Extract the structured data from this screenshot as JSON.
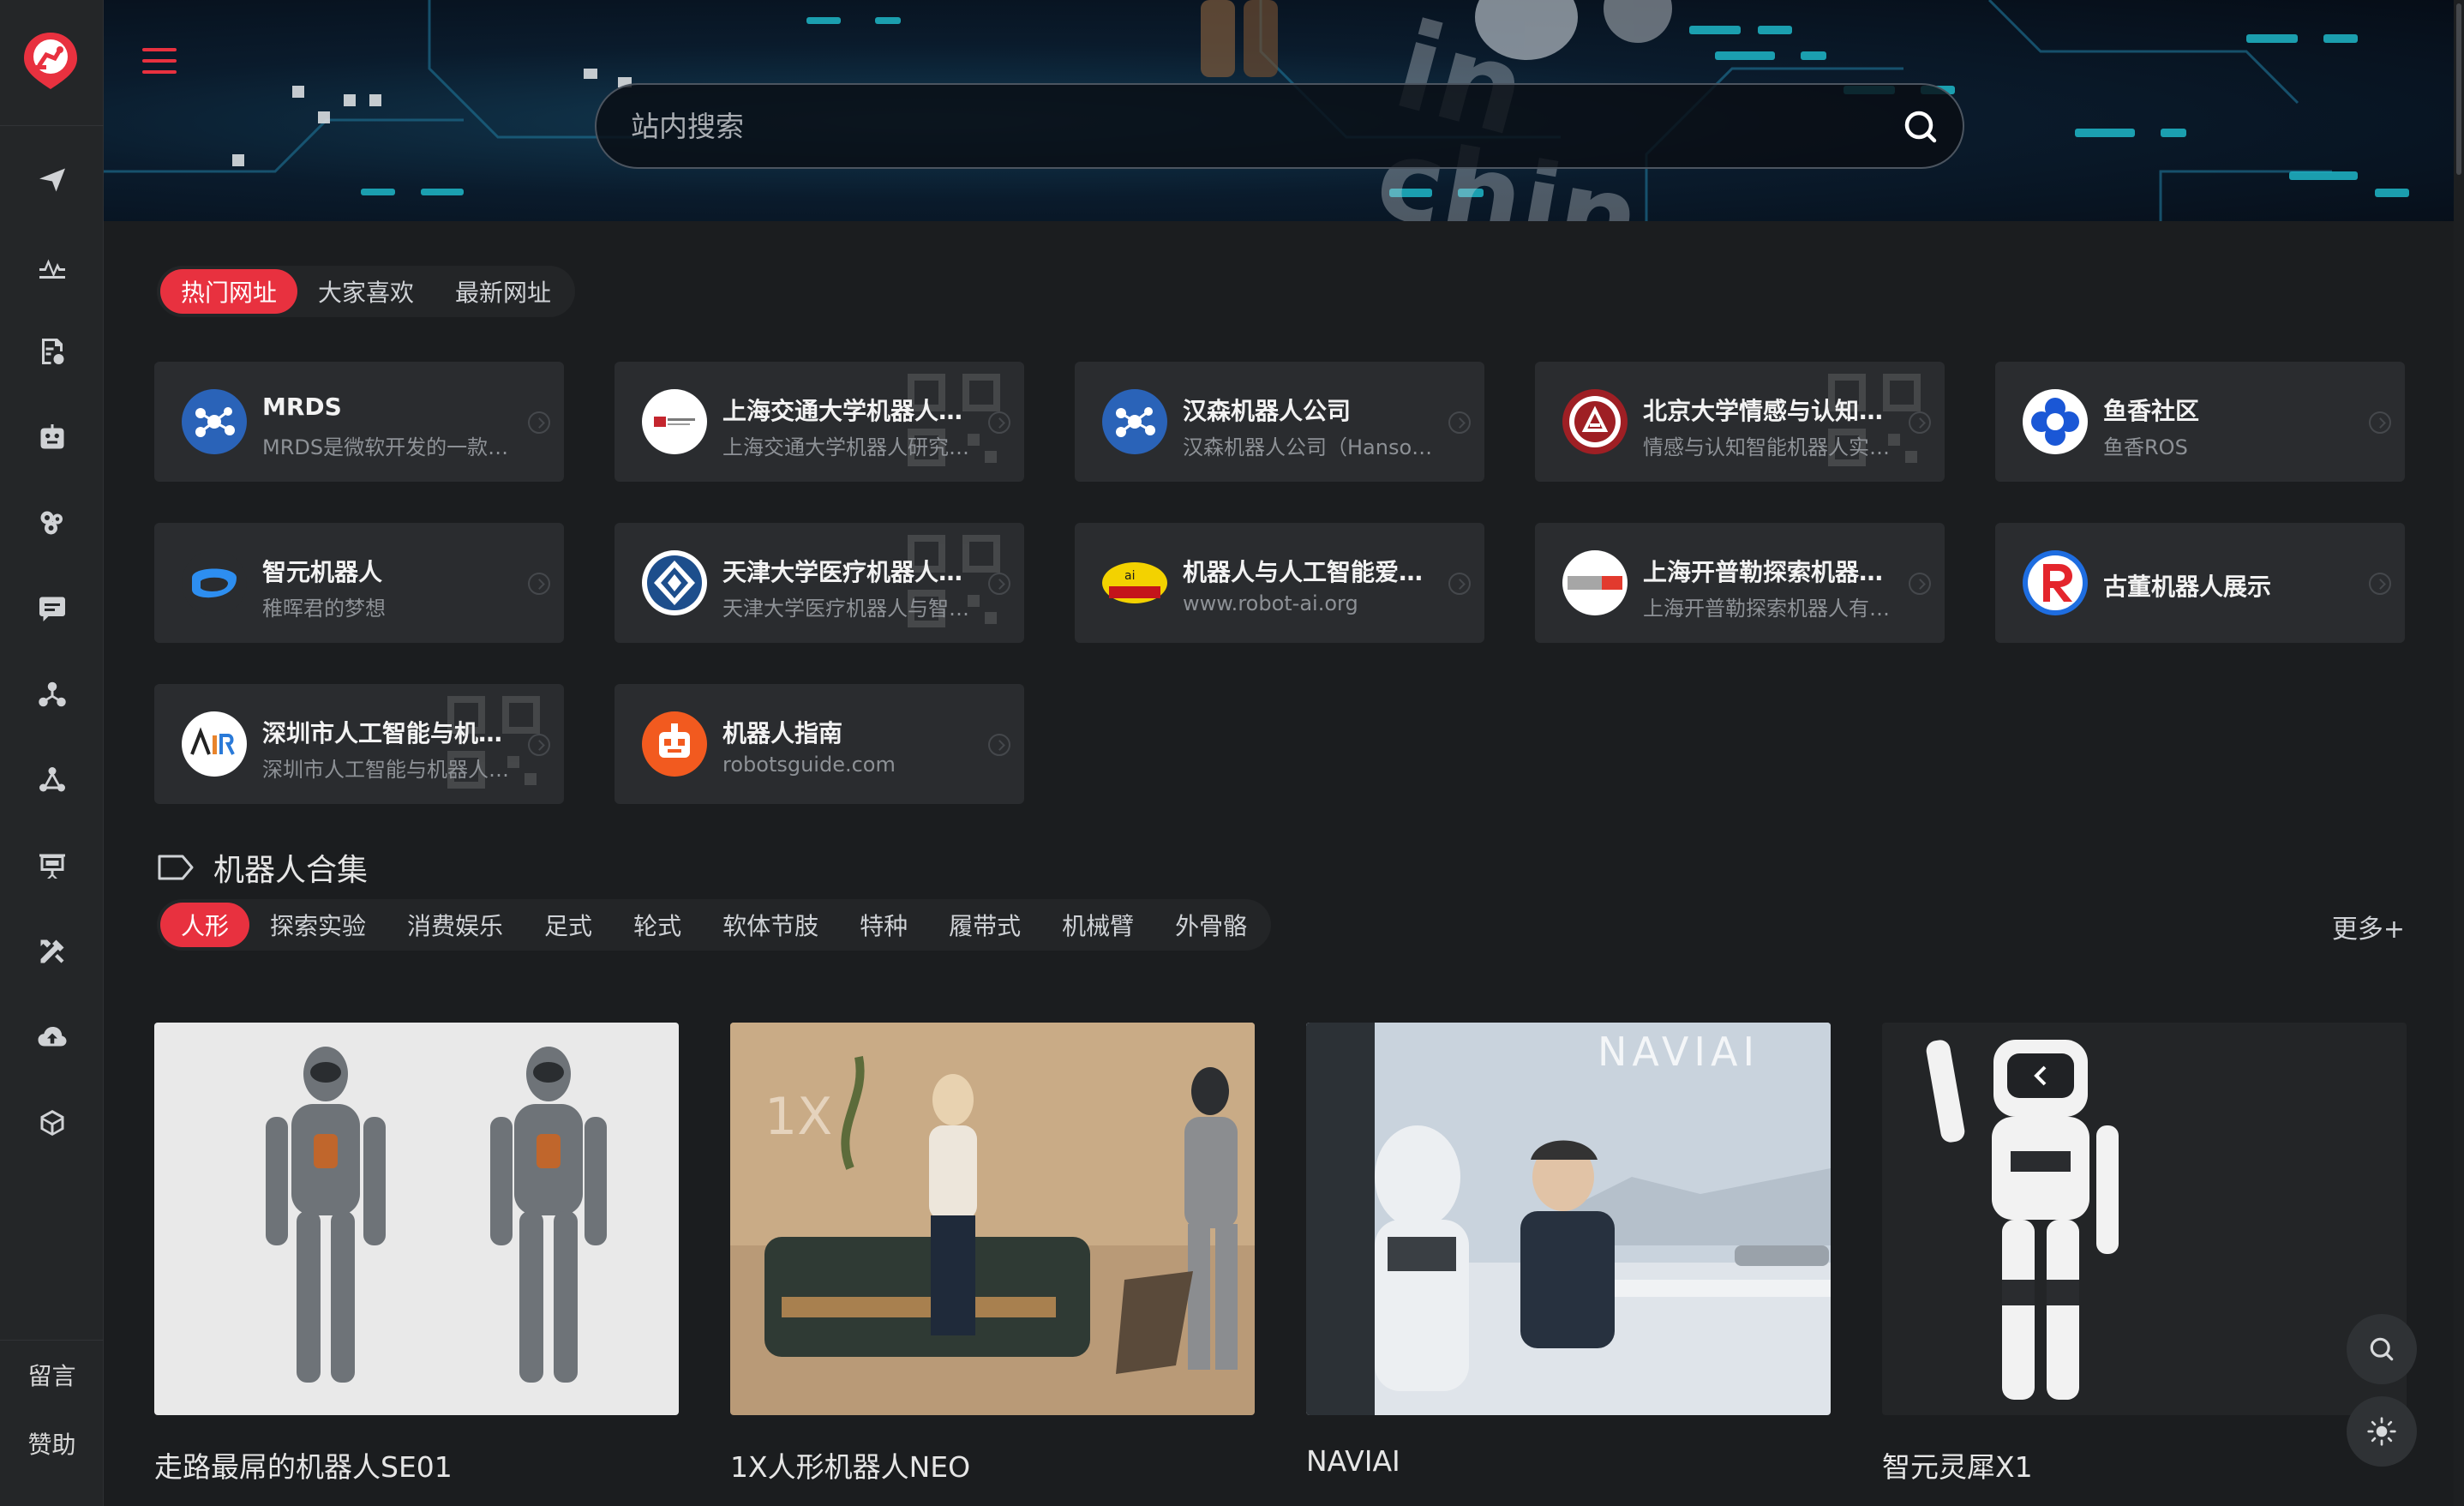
{
  "sidebar": {
    "logo_icon": "robot-arm-logo",
    "nav_icons": [
      "paper-plane-icon",
      "chart-line-icon",
      "document-settings-icon",
      "robot-head-icon",
      "gear-cluster-icon",
      "chat-icon",
      "network-nodes-icon",
      "molecule-icon",
      "presentation-board-icon",
      "tools-icon",
      "cloud-upload-icon",
      "cube-icon"
    ],
    "bottom_links": [
      "留言",
      "赞助"
    ]
  },
  "search": {
    "placeholder": "站内搜索"
  },
  "hot_tabs": [
    "热门网址",
    "大家喜欢",
    "最新网址"
  ],
  "sites": [
    {
      "title": "MRDS",
      "desc": "MRDS是微软开发的一款基...",
      "icon": "nodes-blue-icon",
      "qr": false
    },
    {
      "title": "上海交通大学机器人研...",
      "desc": "上海交通大学机器人研究所...",
      "icon": "sjtu-logo",
      "qr": true
    },
    {
      "title": "汉森机器人公司",
      "desc": "汉森机器人公司（Hanson...",
      "icon": "nodes-blue-icon",
      "qr": false
    },
    {
      "title": "北京大学情感与认知智...",
      "desc": "情感与认知智能机器人实验...",
      "icon": "pku-seal-logo",
      "qr": true
    },
    {
      "title": "鱼香社区",
      "desc": "鱼香ROS",
      "icon": "blue-flower-logo",
      "qr": false
    },
    {
      "title": "智元机器人",
      "desc": "稚晖君的梦想",
      "icon": "agibot-logo",
      "qr": false
    },
    {
      "title": "天津大学医疗机器人与...",
      "desc": "天津大学医疗机器人与智能...",
      "icon": "tju-logo",
      "qr": true
    },
    {
      "title": "机器人与人工智能爱好...",
      "desc": "www.robot-ai.org",
      "icon": "ai-robot-logo",
      "qr": false
    },
    {
      "title": "上海开普勒探索机器人...",
      "desc": "上海开普勒探索机器人有限...",
      "icon": "nullno-logo",
      "qr": false
    },
    {
      "title": "古董机器人展示",
      "desc": "",
      "icon": "red-r-logo",
      "qr": false
    },
    {
      "title": "深圳市人工智能与机器...",
      "desc": "深圳市人工智能与机器人研...",
      "icon": "airs-logo",
      "qr": true
    },
    {
      "title": "机器人指南",
      "desc": "robotsguide.com",
      "icon": "orange-robot-logo",
      "qr": false
    }
  ],
  "section": {
    "title": "机器人合集",
    "categories": [
      "人形",
      "探索实验",
      "消费娱乐",
      "足式",
      "轮式",
      "软体节肢",
      "特种",
      "履带式",
      "机械臂",
      "外骨骼"
    ],
    "more": "更多+"
  },
  "robots": [
    {
      "name": "走路最屌的机器人SE01"
    },
    {
      "name": "1X人形机器人NEO"
    },
    {
      "name": "NAVIAI"
    },
    {
      "name": "智元灵犀X1"
    }
  ],
  "images": {
    "neo_logo": "1X",
    "naviai_logo": "NAVIAI"
  },
  "float_buttons": [
    "search-icon",
    "sun-icon"
  ],
  "colors": {
    "accent": "#e8313f",
    "background": "#1b1d1f",
    "card": "#2a2c2f",
    "sidebar": "#242628"
  }
}
